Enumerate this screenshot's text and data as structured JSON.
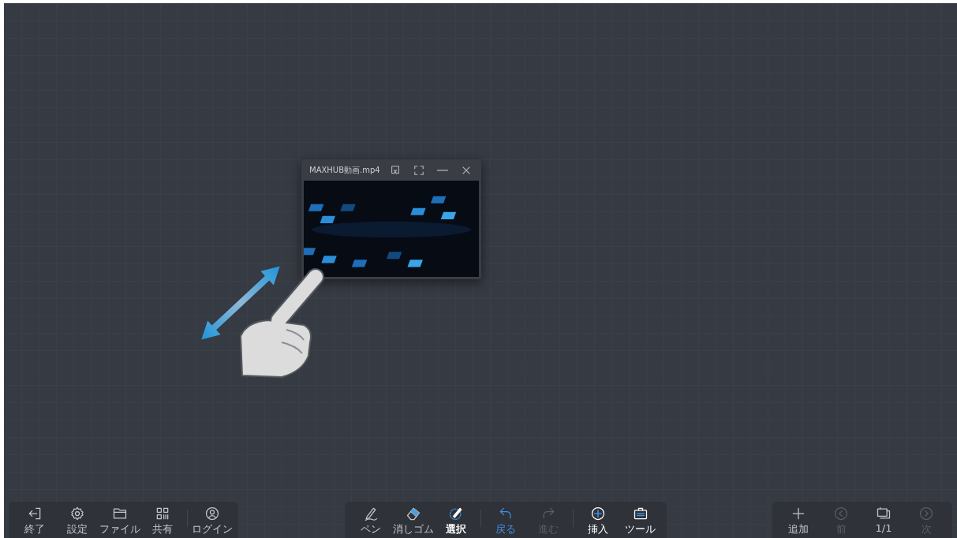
{
  "video_window": {
    "title": "MAXHUB動画.mp4"
  },
  "left_toolbar": [
    {
      "kind": "exit",
      "label": "終了"
    },
    {
      "kind": "settings",
      "label": "設定"
    },
    {
      "kind": "folder",
      "label": "ファイル"
    },
    {
      "kind": "share",
      "label": "共有"
    },
    {
      "kind": "login",
      "label": "ログイン"
    }
  ],
  "center_toolbar": [
    {
      "kind": "pen",
      "label": "ペン",
      "selected": false,
      "disabled": false
    },
    {
      "kind": "eraser",
      "label": "消しゴム",
      "selected": false,
      "disabled": false
    },
    {
      "kind": "select",
      "label": "選択",
      "selected": true,
      "disabled": false
    },
    {
      "kind": "undo",
      "label": "戻る",
      "selected": false,
      "disabled": false
    },
    {
      "kind": "redo",
      "label": "進む",
      "selected": false,
      "disabled": true
    },
    {
      "kind": "insert",
      "label": "挿入",
      "selected": false,
      "disabled": false
    },
    {
      "kind": "tools",
      "label": "ツール",
      "selected": false,
      "disabled": false
    }
  ],
  "right_toolbar": [
    {
      "kind": "add",
      "label": "追加",
      "disabled": false
    },
    {
      "kind": "prev",
      "label": "前",
      "disabled": true
    },
    {
      "kind": "pages",
      "label": "1/1",
      "disabled": false
    },
    {
      "kind": "next",
      "label": "次",
      "disabled": true
    }
  ]
}
